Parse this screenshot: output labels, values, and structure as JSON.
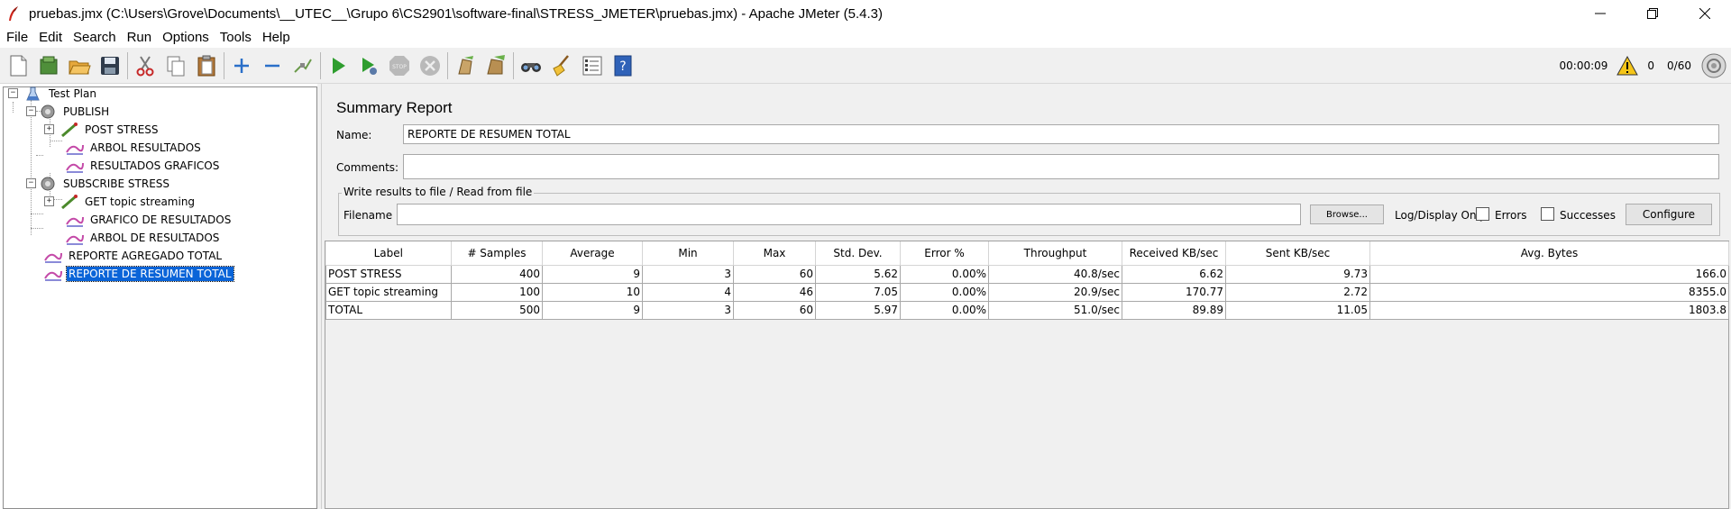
{
  "window": {
    "title": "pruebas.jmx (C:\\Users\\Grove\\Documents\\__UTEC__\\Grupo 6\\CS2901\\software-final\\STRESS_JMETER\\pruebas.jmx) - Apache JMeter (5.4.3)",
    "controls": [
      "minimize-icon",
      "restore-icon",
      "close-icon"
    ]
  },
  "menu": {
    "items": [
      {
        "label": "File"
      },
      {
        "label": "Edit"
      },
      {
        "label": "Search"
      },
      {
        "label": "Run"
      },
      {
        "label": "Options"
      },
      {
        "label": "Tools"
      },
      {
        "label": "Help"
      }
    ]
  },
  "toolbar": {
    "buttons": [
      "new-icon",
      "templates-icon",
      "open-icon",
      "save-icon",
      "cut-icon",
      "copy-icon",
      "paste-icon",
      "expand-icon",
      "collapse-icon",
      "toggle-icon",
      "start-icon",
      "start-no-pauses-icon",
      "stop-icon",
      "shutdown-icon",
      "clear-icon",
      "clear-all-icon",
      "search-icon",
      "reset-search-icon",
      "function-helper-icon",
      "help-icon"
    ],
    "elapsed_time": "00:00:09",
    "error_count": "0",
    "active_threads": "0/60"
  },
  "tree": {
    "nodes": [
      {
        "label": "Test Plan",
        "icon": "test-plan-icon"
      },
      {
        "label": "PUBLISH",
        "icon": "thread-group-icon"
      },
      {
        "label": "POST STRESS",
        "icon": "sampler-icon"
      },
      {
        "label": "ARBOL RESULTADOS",
        "icon": "listener-icon"
      },
      {
        "label": "RESULTADOS GRAFICOS",
        "icon": "listener-icon"
      },
      {
        "label": "SUBSCRIBE STRESS",
        "icon": "thread-group-icon"
      },
      {
        "label": "GET topic streaming",
        "icon": "sampler-icon"
      },
      {
        "label": "GRAFICO DE RESULTADOS",
        "icon": "listener-icon"
      },
      {
        "label": "ARBOL DE RESULTADOS",
        "icon": "listener-icon"
      },
      {
        "label": "REPORTE AGREGADO TOTAL",
        "icon": "listener-icon"
      },
      {
        "label": "REPORTE DE RESUMEN TOTAL",
        "icon": "listener-icon"
      }
    ]
  },
  "panel": {
    "title": "Summary Report",
    "name_label": "Name:",
    "name_value": "REPORTE DE RESUMEN TOTAL",
    "comments_label": "Comments:",
    "comments_value": "",
    "file_group_title": "Write results to file / Read from file",
    "filename_label": "Filename",
    "filename_value": "",
    "browse_label": "Browse...",
    "log_display_label": "Log/Display Only:",
    "errors_label": "Errors",
    "errors_checked": false,
    "successes_label": "Successes",
    "successes_checked": false,
    "configure_label": "Configure"
  },
  "table": {
    "columns": [
      "Label",
      "# Samples",
      "Average",
      "Min",
      "Max",
      "Std. Dev.",
      "Error %",
      "Throughput",
      "Received KB/sec",
      "Sent KB/sec",
      "Avg. Bytes"
    ],
    "rows": [
      [
        "POST STRESS",
        "400",
        "9",
        "3",
        "60",
        "5.62",
        "0.00%",
        "40.8/sec",
        "6.62",
        "9.73",
        "166.0"
      ],
      [
        "GET topic streaming",
        "100",
        "10",
        "4",
        "46",
        "7.05",
        "0.00%",
        "20.9/sec",
        "170.77",
        "2.72",
        "8355.0"
      ],
      [
        "TOTAL",
        "500",
        "9",
        "3",
        "60",
        "5.97",
        "0.00%",
        "51.0/sec",
        "89.89",
        "11.05",
        "1803.8"
      ]
    ]
  }
}
